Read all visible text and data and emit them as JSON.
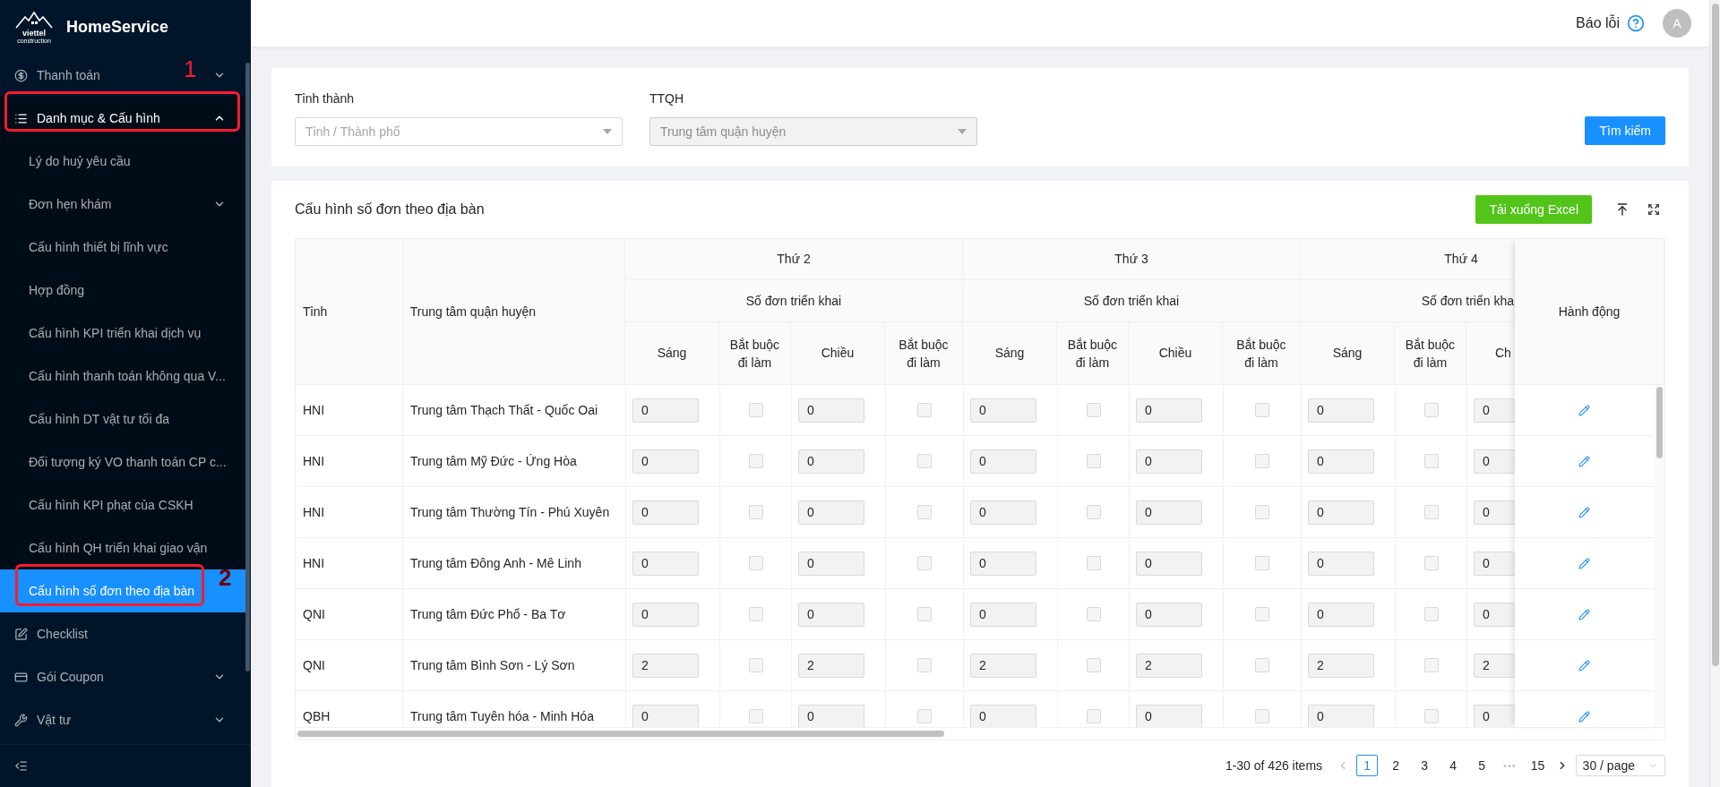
{
  "sidebar": {
    "logo": {
      "brand": "viettel",
      "tagline": "construction"
    },
    "app_name": "HomeService",
    "items": [
      {
        "label": "Thanh toán",
        "expanded": false,
        "selected": false
      },
      {
        "label": "Danh mục & Cấu hình",
        "expanded": true,
        "selected": false,
        "annotation": "1",
        "children": [
          {
            "label": "Lý do huỷ yêu cầu",
            "selected": false
          },
          {
            "label": "Đơn hẹn khám",
            "selected": false,
            "expanded": false
          },
          {
            "label": "Cấu hình thiết bị lĩnh vực",
            "selected": false
          },
          {
            "label": "Hợp đồng",
            "selected": false
          },
          {
            "label": "Cấu hình KPI triển khai dịch vụ",
            "selected": false
          },
          {
            "label": "Cấu hình thanh toán không qua V...",
            "selected": false
          },
          {
            "label": "Cấu hình DT vật tư tối đa",
            "selected": false
          },
          {
            "label": "Đối tượng ký VO thanh toán CP c...",
            "selected": false
          },
          {
            "label": "Cấu hình KPI phạt của CSKH",
            "selected": false
          },
          {
            "label": "Cấu hình QH triển khai giao vận",
            "selected": false
          },
          {
            "label": "Cấu hình số đơn theo địa bàn",
            "selected": true,
            "annotation": "2"
          }
        ]
      },
      {
        "label": "Checklist",
        "selected": false
      },
      {
        "label": "Gói Coupon",
        "expanded": false,
        "selected": false
      },
      {
        "label": "Vật tư",
        "expanded": false,
        "selected": false
      }
    ]
  },
  "header": {
    "report_label": "Báo lỗi",
    "avatar": "A"
  },
  "filters": {
    "fields": [
      {
        "label": "Tỉnh thành",
        "placeholder": "Tỉnh / Thành phố",
        "disabled": false
      },
      {
        "label": "TTQH",
        "placeholder": "Trung tâm quận huyện",
        "disabled": true
      }
    ],
    "search_button": "Tìm kiếm"
  },
  "table_card": {
    "title": "Cấu hình số đơn theo địa bàn",
    "export_button": "Tải xuống Excel",
    "columns": {
      "province": "Tỉnh",
      "center": "Trung tâm quận huyện",
      "action": "Hành động"
    },
    "days": [
      {
        "title": "Thứ 2",
        "group": "Số đơn triển khai",
        "columns": [
          "Sáng",
          "Bắt buộc đi làm",
          "Chiều",
          "Bắt buộc đi làm"
        ]
      },
      {
        "title": "Thứ 3",
        "group": "Số đơn triển khai",
        "columns": [
          "Sáng",
          "Bắt buộc đi làm",
          "Chiều",
          "Bắt buộc đi làm"
        ]
      },
      {
        "title": "Thứ 4",
        "group": "Số đơn triển kha",
        "columns": [
          "Sáng",
          "Bắt buộc đi làm",
          "Ch"
        ]
      }
    ],
    "rows": [
      {
        "province": "HNI",
        "center": "Trung tâm Thạch Thất - Quốc Oai",
        "days": [
          [
            "0",
            false,
            "0",
            false
          ],
          [
            "0",
            false,
            "0",
            false
          ],
          [
            "0",
            false,
            "0"
          ]
        ]
      },
      {
        "province": "HNI",
        "center": "Trung tâm Mỹ Đức - Ứng Hòa",
        "days": [
          [
            "0",
            false,
            "0",
            false
          ],
          [
            "0",
            false,
            "0",
            false
          ],
          [
            "0",
            false,
            "0"
          ]
        ]
      },
      {
        "province": "HNI",
        "center": "Trung tâm Thường Tín - Phú Xuyên",
        "days": [
          [
            "0",
            false,
            "0",
            false
          ],
          [
            "0",
            false,
            "0",
            false
          ],
          [
            "0",
            false,
            "0"
          ]
        ]
      },
      {
        "province": "HNI",
        "center": "Trung tâm Đông Anh - Mê Linh",
        "days": [
          [
            "0",
            false,
            "0",
            false
          ],
          [
            "0",
            false,
            "0",
            false
          ],
          [
            "0",
            false,
            "0"
          ]
        ]
      },
      {
        "province": "QNI",
        "center": "Trung tâm Đức Phổ - Ba Tơ",
        "days": [
          [
            "0",
            false,
            "0",
            false
          ],
          [
            "0",
            false,
            "0",
            false
          ],
          [
            "0",
            false,
            "0"
          ]
        ]
      },
      {
        "province": "QNI",
        "center": "Trung tâm Bình Sơn - Lý Sơn",
        "days": [
          [
            "2",
            false,
            "2",
            false
          ],
          [
            "2",
            false,
            "2",
            false
          ],
          [
            "2",
            false,
            "2"
          ]
        ]
      },
      {
        "province": "QBH",
        "center": "Trung tâm Tuyên hóa - Minh Hóa",
        "days": [
          [
            "0",
            false,
            "0",
            false
          ],
          [
            "0",
            false,
            "0",
            false
          ],
          [
            "0",
            false,
            "0"
          ]
        ]
      }
    ],
    "pagination": {
      "summary": "1-30 of 426 items",
      "pages": [
        {
          "kind": "page",
          "label": "1",
          "selected": true
        },
        {
          "kind": "page",
          "label": "2",
          "selected": false
        },
        {
          "kind": "page",
          "label": "3",
          "selected": false
        },
        {
          "kind": "page",
          "label": "4",
          "selected": false
        },
        {
          "kind": "page",
          "label": "5",
          "selected": false
        },
        {
          "kind": "ellipsis",
          "label": "•••"
        },
        {
          "kind": "page",
          "label": "15",
          "selected": false
        }
      ],
      "page_size": "30 / page"
    }
  }
}
